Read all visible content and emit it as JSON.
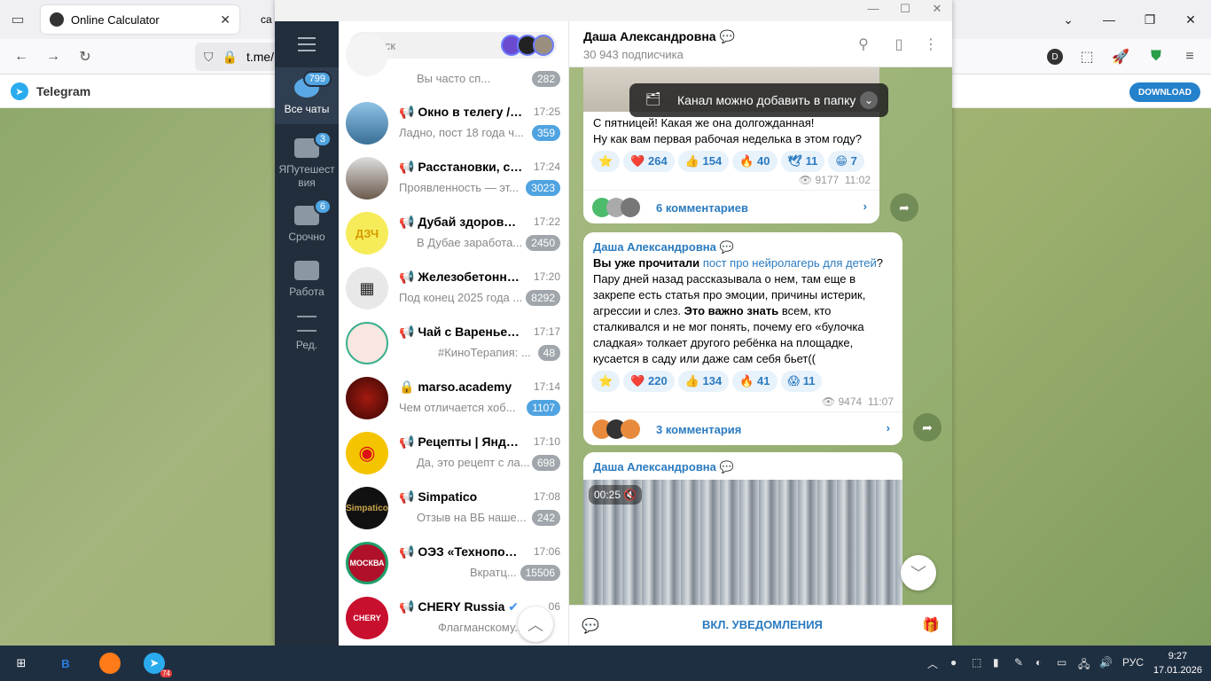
{
  "browser": {
    "tabs": [
      {
        "title": "Online Calculator"
      },
      {
        "title": "ca"
      }
    ],
    "url": "t.me/"
  },
  "telegram_bar": {
    "title": "Telegram",
    "download_label": "DOWNLOAD"
  },
  "folders": [
    {
      "label": "Все чаты",
      "badge": "799"
    },
    {
      "label": "ЯПутешествия",
      "badge": "3"
    },
    {
      "label": "Срочно",
      "badge": "6"
    },
    {
      "label": "Работа",
      "badge": ""
    },
    {
      "label": "Ред.",
      "badge": ""
    }
  ],
  "search": {
    "placeholder": "Поиск"
  },
  "chats": [
    {
      "name": "",
      "time": "",
      "preview": "Вы часто сп...",
      "count": "282",
      "unmuted": false
    },
    {
      "name": "Окно в телегу / Б...",
      "time": "17:25",
      "preview": "Ладно, пост 18 года  ч...",
      "count": "359",
      "unmuted": true
    },
    {
      "name": "Расстановки, с Ла...",
      "time": "17:24",
      "preview": "Проявленность — эт...",
      "count": "3023",
      "unmuted": true
    },
    {
      "name": "Дубай здорового ...",
      "time": "17:22",
      "preview": "В Дубае заработа...",
      "count": "2450",
      "unmuted": false
    },
    {
      "name": "Железобетонный...",
      "time": "17:20",
      "preview": "Под конец 2025 года ...",
      "count": "8292",
      "unmuted": false
    },
    {
      "name": "Чай с Вареньем | ...",
      "time": "17:17",
      "preview": "#КиноТерапия: ...",
      "count": "48",
      "unmuted": false
    },
    {
      "name": "marso.academy",
      "time": "17:14",
      "preview": "Чем отличается хоб...",
      "count": "1107",
      "unmuted": true
    },
    {
      "name": "Рецепты | Яндекс...",
      "time": "17:10",
      "preview": "Да, это рецепт с ла...",
      "count": "698",
      "unmuted": false
    },
    {
      "name": "Simpatico",
      "time": "17:08",
      "preview": "Отзыв на ВБ наше...",
      "count": "242",
      "unmuted": false
    },
    {
      "name": "ОЭЗ «Технополис ...",
      "time": "17:06",
      "preview": "Вкратц...",
      "count": "15506",
      "unmuted": false
    },
    {
      "name": "CHERY Russia",
      "time": "06",
      "preview": "Флагманскому...",
      "count": "",
      "unmuted": false
    }
  ],
  "channel": {
    "title": "Даша Александровна",
    "subtitle": "30 943 подписчика"
  },
  "toast": "Канал можно добавить в папку",
  "messages": [
    {
      "text": "С пятницей! Какая же она долгожданная!\nНу как вам первая рабочая неделька в этом году?",
      "reactions": [
        {
          "emoji": "⭐",
          "count": ""
        },
        {
          "emoji": "❤️",
          "count": "264"
        },
        {
          "emoji": "👍",
          "count": "154"
        },
        {
          "emoji": "🔥",
          "count": "40"
        },
        {
          "emoji": "🕊",
          "count": "11"
        },
        {
          "emoji": "😁",
          "count": "7"
        }
      ],
      "views": "9177",
      "time": "11:02",
      "comments": "6 комментариев"
    },
    {
      "author": "Даша Александровна",
      "text_bold1": "Вы уже прочитали",
      "text_link": "пост про нейролагерь для детей",
      "text_mid": "? Пару дней назад рассказывала о нем, там еще в закрепе есть статья про эмоции, причины истерик, агрессии и слез.",
      "text_bold2": "Это важно знать",
      "text_end": "всем, кто сталкивался и не мог понять, почему его «булочка сладкая» толкает другого ребёнка на площадке, кусается в саду или даже сам себя бьет((",
      "reactions": [
        {
          "emoji": "⭐",
          "count": ""
        },
        {
          "emoji": "❤️",
          "count": "220"
        },
        {
          "emoji": "👍",
          "count": "134"
        },
        {
          "emoji": "🔥",
          "count": "41"
        },
        {
          "emoji": "😱",
          "count": "11"
        }
      ],
      "views": "9474",
      "time": "11:07",
      "comments": "3 комментария"
    },
    {
      "author": "Даша Александровна",
      "video_time": "00:25"
    }
  ],
  "bottom_bar": {
    "label": "ВКЛ. УВЕДОМЛЕНИЯ"
  },
  "taskbar": {
    "lang": "РУС",
    "time": "9:27",
    "date": "17.01.2026",
    "telegram_badge": "74"
  },
  "colors": {
    "accent": "#2481cc",
    "rail": "#232e3c",
    "badge": "#4fa3e0"
  }
}
